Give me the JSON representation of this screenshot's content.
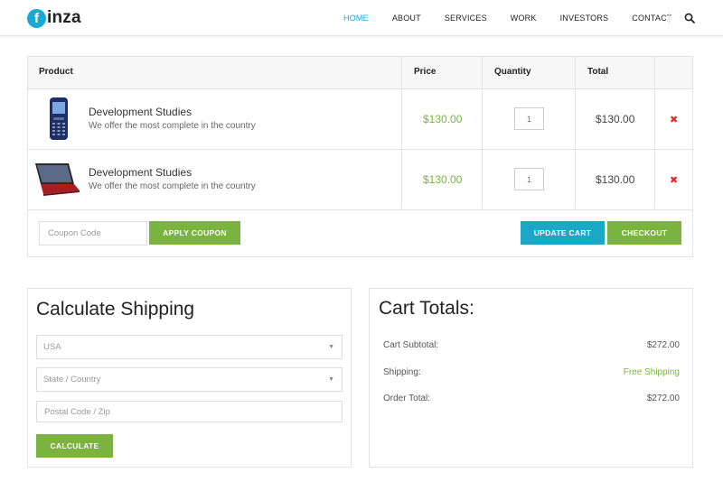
{
  "logo": {
    "letter": "f",
    "text": "inza"
  },
  "nav": {
    "items": [
      {
        "label": "HOME",
        "active": true
      },
      {
        "label": "ABOUT",
        "active": false
      },
      {
        "label": "SERVICES",
        "active": false
      },
      {
        "label": "WORK",
        "active": false
      },
      {
        "label": "INVESTORS",
        "active": false
      },
      {
        "label": "CONTACT",
        "active": false
      }
    ],
    "search_icon": "search-icon"
  },
  "cart": {
    "headers": {
      "product": "Product",
      "price": "Price",
      "quantity": "Quantity",
      "total": "Total"
    },
    "rows": [
      {
        "image": "phone-icon",
        "name": "Development Studies",
        "description": "We offer the most complete in the country",
        "price": "$130.00",
        "quantity": "1",
        "total": "$130.00",
        "remove": "✖"
      },
      {
        "image": "laptop-icon",
        "name": "Development Studies",
        "description": "We offer the most complete in the country",
        "price": "$130.00",
        "quantity": "1",
        "total": "$130.00",
        "remove": "✖"
      }
    ],
    "coupon_placeholder": "Coupon Code",
    "apply_coupon": "APPLY COUPON",
    "update_cart": "UPDATE CART",
    "checkout": "CHECKOUT"
  },
  "shipping": {
    "title": "Calculate Shipping",
    "country": "USA",
    "state_placeholder": "State / Country",
    "postal_placeholder": "Postal Code / Zip",
    "calculate": "CALCULATE"
  },
  "totals": {
    "title": "Cart Totals:",
    "subtotal_label": "Cart Subtotal:",
    "subtotal_value": "$272.00",
    "shipping_label": "Shipping:",
    "shipping_value": "Free Shipping",
    "order_label": "Order Total:",
    "order_value": "$272.00"
  },
  "colors": {
    "accent_blue": "#1ba8d3",
    "accent_green": "#7ab33f",
    "remove_red": "#e02b2b"
  }
}
